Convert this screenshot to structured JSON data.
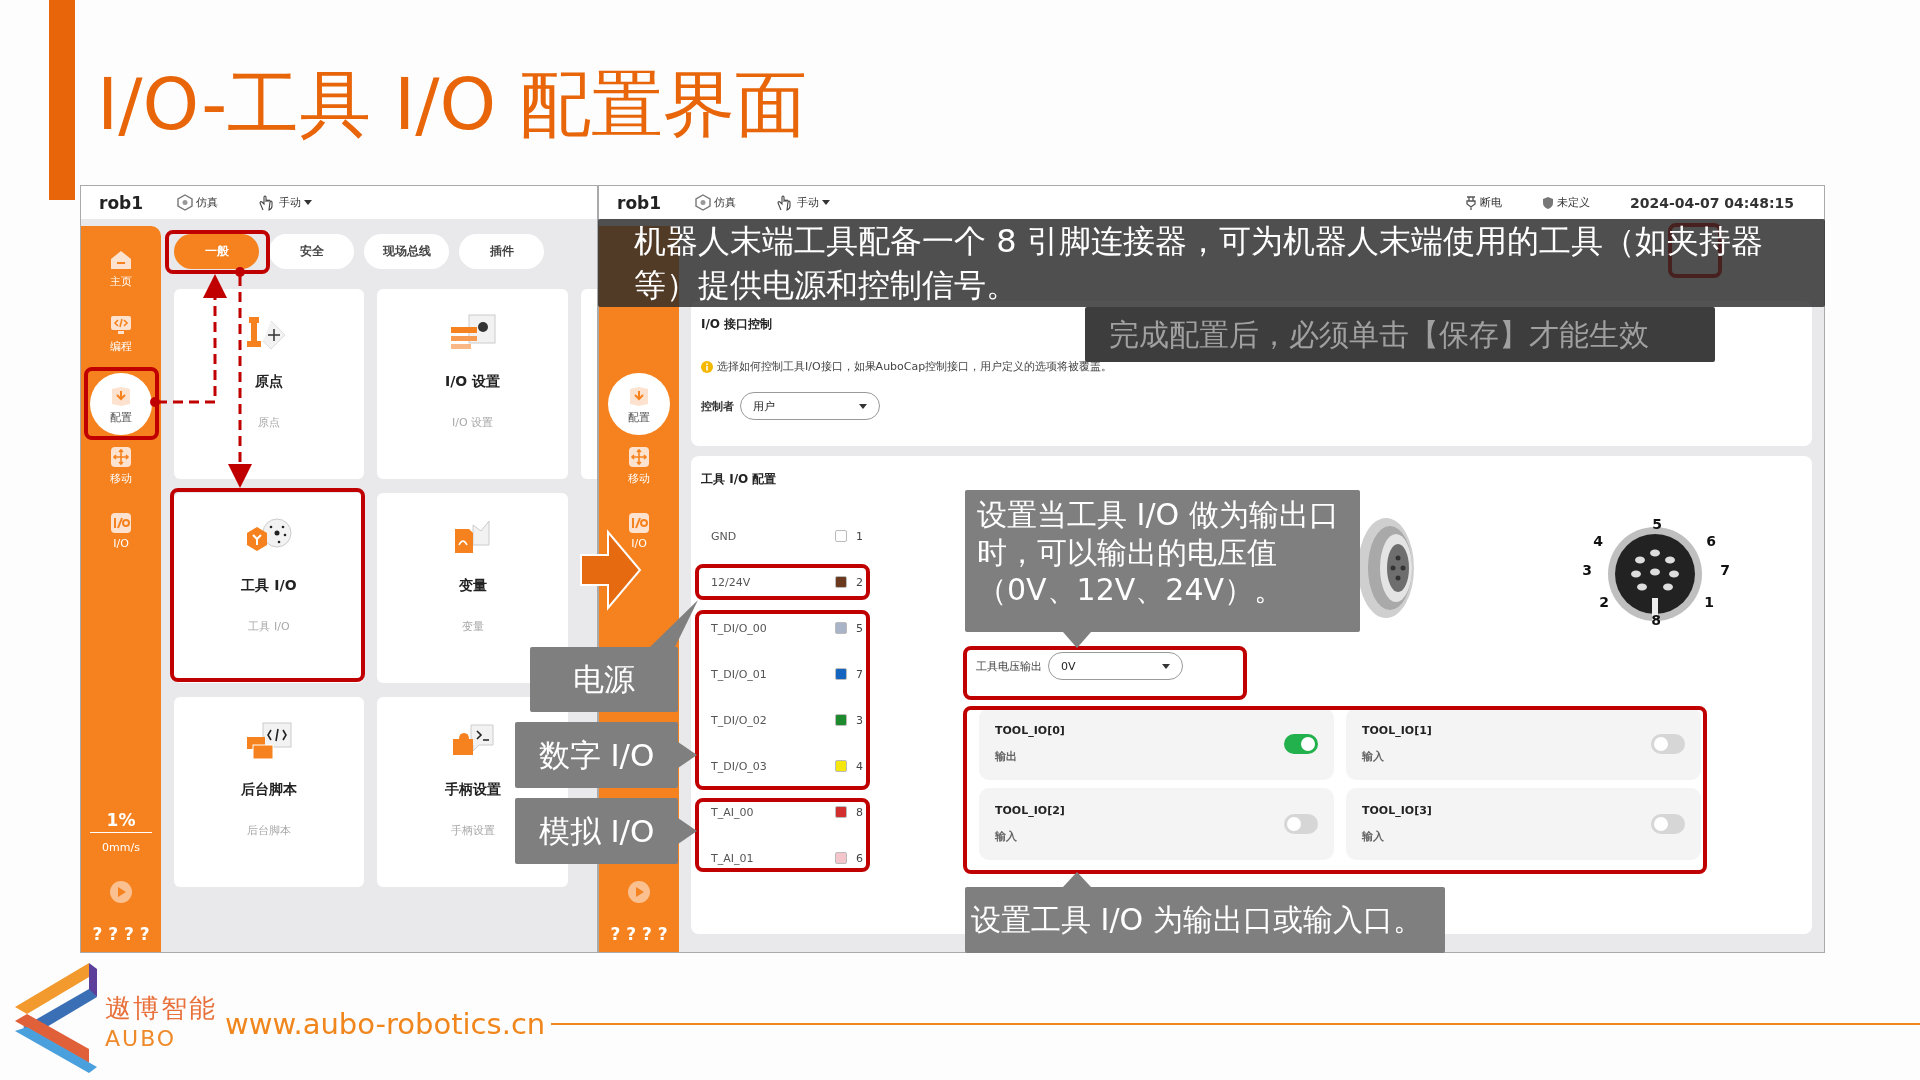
{
  "title": "I/O-工具 I/O 配置界面",
  "left_screen": {
    "top_bar": {
      "robot": "rob1",
      "mode": "仿真",
      "control": "手动"
    },
    "sidebar": {
      "items": [
        {
          "label": "主页",
          "selected": false
        },
        {
          "label": "编程",
          "selected": false
        },
        {
          "label": "配置",
          "selected": true
        },
        {
          "label": "移动",
          "selected": false
        },
        {
          "label": "I/O",
          "selected": false
        }
      ],
      "speed_percent": "1%",
      "speed": "0mm/s",
      "status": "? ? ? ?"
    },
    "tabs": [
      {
        "label": "一般",
        "selected": true
      },
      {
        "label": "安全",
        "selected": false
      },
      {
        "label": "现场总线",
        "selected": false
      },
      {
        "label": "插件",
        "selected": false
      }
    ],
    "cards": [
      {
        "title": "原点",
        "subtitle": "原点"
      },
      {
        "title": "I/O 设置",
        "subtitle": "I/O 设置"
      },
      {
        "title": "工具 I/O",
        "subtitle": "工具 I/O"
      },
      {
        "title": "变量",
        "subtitle": "变量"
      },
      {
        "title": "后台脚本",
        "subtitle": "后台脚本"
      },
      {
        "title": "手柄设置",
        "subtitle": "手柄设置"
      }
    ]
  },
  "right_screen": {
    "top_bar": {
      "robot": "rob1",
      "mode": "仿真",
      "control": "手动",
      "power": "断电",
      "safety": "未定义",
      "datetime": "2024-04-07 04:48:15"
    },
    "sidebar": {
      "items": [
        {
          "label": "配置",
          "selected": true
        },
        {
          "label": "移动",
          "selected": false
        },
        {
          "label": "I/O",
          "selected": false
        }
      ],
      "status": "? ? ? ?"
    },
    "interface_panel": {
      "title": "I/O 接口控制",
      "info": "选择如何控制工具I/O接口，如果AuboCap控制接口，用户定义的选项将被覆盖。",
      "controller_label": "控制者",
      "controller_value": "用户"
    },
    "config_panel": {
      "title": "工具 I/O 配置",
      "pins": [
        {
          "name": "GND",
          "number": "1",
          "color": "#ffffff"
        },
        {
          "name": "12/24V",
          "number": "2",
          "color": "#6b3a1e"
        },
        {
          "name": "T_DI/O_00",
          "number": "5",
          "color": "#a9b4c8"
        },
        {
          "name": "T_DI/O_01",
          "number": "7",
          "color": "#1565c0"
        },
        {
          "name": "T_DI/O_02",
          "number": "3",
          "color": "#1e8a2e"
        },
        {
          "name": "T_DI/O_03",
          "number": "4",
          "color": "#f5e60f"
        },
        {
          "name": "T_AI_00",
          "number": "8",
          "color": "#d32f2f"
        },
        {
          "name": "T_AI_01",
          "number": "6",
          "color": "#f4c6cb"
        }
      ],
      "pin_labels": [
        "5",
        "6",
        "7",
        "1",
        "8",
        "2",
        "3",
        "4"
      ],
      "voltage_label": "工具电压输出",
      "voltage_value": "0V",
      "tool_ios": [
        {
          "name": "TOOL_IO[0]",
          "mode": "输出",
          "on": true
        },
        {
          "name": "TOOL_IO[1]",
          "mode": "输入",
          "on": false
        },
        {
          "name": "TOOL_IO[2]",
          "mode": "输入",
          "on": false
        },
        {
          "name": "TOOL_IO[3]",
          "mode": "输入",
          "on": false
        }
      ]
    }
  },
  "annotations": {
    "banner": "机器人末端工具配备一个 8 引脚连接器，可为机器人末端使用的工具（如夹持器等）提供电源和控制信号。",
    "save_note": "完成配置后，必须单击【保存】才能生效",
    "power": "电源",
    "digital": "数字 I/O",
    "analog": "模拟 I/O",
    "voltage_note": "设置当工具 I/O 做为输出口时，可以输出的电压值（0V、12V、24V）。",
    "io_note": "设置工具 I/O 为输出口或输入口。"
  },
  "footer": {
    "brand_cn": "遨博智能",
    "brand_en": "AUBO",
    "url": "www.aubo-robotics.cn"
  }
}
